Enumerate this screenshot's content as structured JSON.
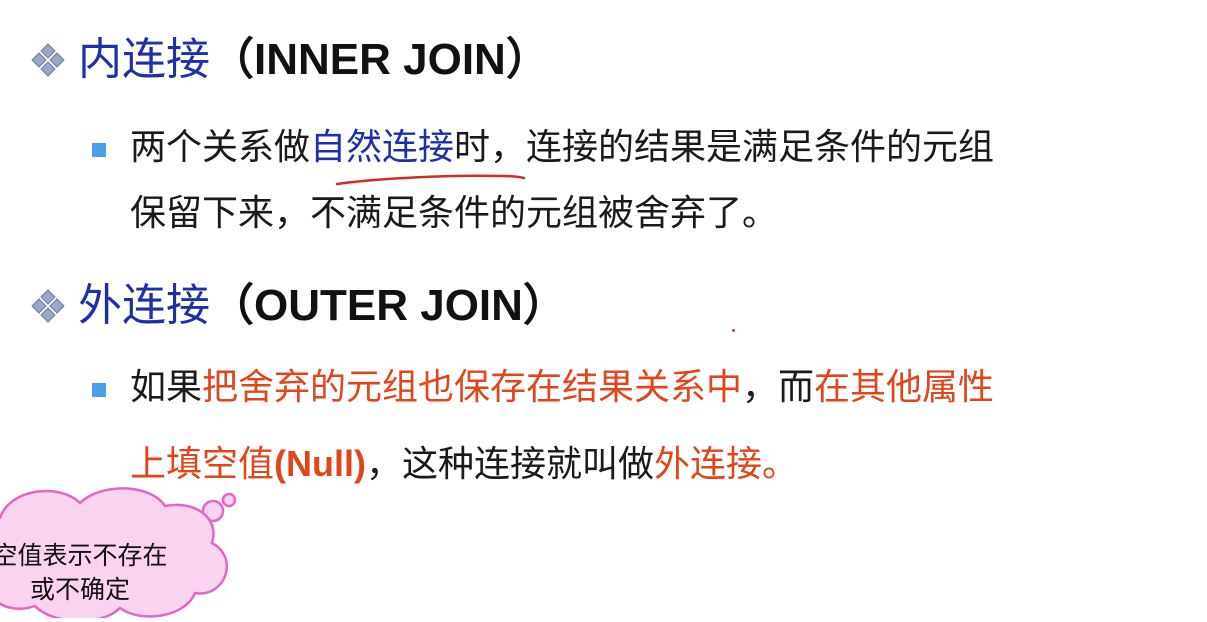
{
  "section1": {
    "heading_cn": "内连接",
    "heading_en": "（INNER JOIN）",
    "bullet": {
      "line1": {
        "a": "两个关系做",
        "b_highlight": "自然连接",
        "c": "时，连接的结果是满足条件的元组"
      },
      "line2": "保留下来，不满足条件的元组被舍弃了。"
    }
  },
  "section2": {
    "heading_cn": "外连接",
    "heading_en": "（OUTER JOIN）",
    "bullet": {
      "line1": {
        "a": "如果",
        "b_red": "把舍弃的元组也保存在结果关系中",
        "c": "，而",
        "d_red": "在其他属性"
      },
      "line2": {
        "a_red": "上填空值",
        "b_bold_red": "(Null)",
        "c": "，这种连接就叫做",
        "d_red": "外连接。"
      }
    }
  },
  "callout": {
    "line1": "空值表示不存在",
    "line2": "或不确定"
  },
  "colors": {
    "heading_blue": "#1f2fa8",
    "emphasis_red": "#e2451a",
    "bullet_blue": "#4aa0e8",
    "cloud_fill": "#f9d3f0",
    "cloud_stroke": "#e266c8"
  }
}
